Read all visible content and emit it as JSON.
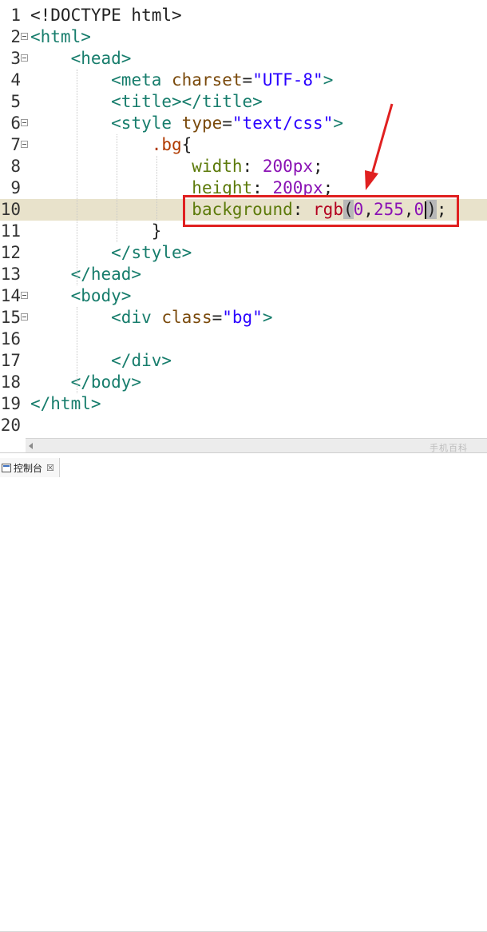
{
  "editor": {
    "lines": [
      {
        "num": "1",
        "tokens": [
          {
            "t": "<!DOCTYPE html>",
            "c": "default"
          }
        ]
      },
      {
        "num": "2",
        "tokens": [
          {
            "t": "<html>",
            "c": "tag"
          }
        ]
      },
      {
        "num": "3",
        "tokens": [
          {
            "t": "    ",
            "c": "default"
          },
          {
            "t": "<head>",
            "c": "tag"
          }
        ]
      },
      {
        "num": "4",
        "tokens": [
          {
            "t": "        ",
            "c": "default"
          },
          {
            "t": "<meta ",
            "c": "tag"
          },
          {
            "t": "charset",
            "c": "attr"
          },
          {
            "t": "=",
            "c": "default"
          },
          {
            "t": "\"UTF-8\"",
            "c": "str"
          },
          {
            "t": ">",
            "c": "tag"
          }
        ]
      },
      {
        "num": "5",
        "tokens": [
          {
            "t": "        ",
            "c": "default"
          },
          {
            "t": "<title></title>",
            "c": "tag"
          }
        ]
      },
      {
        "num": "6",
        "tokens": [
          {
            "t": "        ",
            "c": "default"
          },
          {
            "t": "<style ",
            "c": "tag"
          },
          {
            "t": "type",
            "c": "attr"
          },
          {
            "t": "=",
            "c": "default"
          },
          {
            "t": "\"text/css\"",
            "c": "str"
          },
          {
            "t": ">",
            "c": "tag"
          }
        ]
      },
      {
        "num": "7",
        "tokens": [
          {
            "t": "            ",
            "c": "default"
          },
          {
            "t": ".bg",
            "c": "sel"
          },
          {
            "t": "{",
            "c": "default"
          }
        ]
      },
      {
        "num": "8",
        "tokens": [
          {
            "t": "                ",
            "c": "default"
          },
          {
            "t": "width",
            "c": "prop"
          },
          {
            "t": ": ",
            "c": "default"
          },
          {
            "t": "200px",
            "c": "num"
          },
          {
            "t": ";",
            "c": "default"
          }
        ]
      },
      {
        "num": "9",
        "tokens": [
          {
            "t": "                ",
            "c": "default"
          },
          {
            "t": "height",
            "c": "prop"
          },
          {
            "t": ": ",
            "c": "default"
          },
          {
            "t": "200px",
            "c": "num"
          },
          {
            "t": ";",
            "c": "default"
          }
        ]
      },
      {
        "num": "10",
        "tokens": [
          {
            "t": "                ",
            "c": "default"
          },
          {
            "t": "background",
            "c": "prop"
          },
          {
            "t": ": ",
            "c": "default"
          },
          {
            "t": "rgb",
            "c": "fn"
          },
          {
            "t": "(",
            "c": "paren"
          },
          {
            "t": "0",
            "c": "num"
          },
          {
            "t": ",",
            "c": "default"
          },
          {
            "t": "255",
            "c": "num"
          },
          {
            "t": ",",
            "c": "default"
          },
          {
            "t": "0",
            "c": "num"
          },
          {
            "t": "caret",
            "c": "caret"
          },
          {
            "t": ")",
            "c": "paren"
          },
          {
            "t": ";",
            "c": "default"
          }
        ]
      },
      {
        "num": "11",
        "tokens": [
          {
            "t": "            ",
            "c": "default"
          },
          {
            "t": "}",
            "c": "default"
          }
        ]
      },
      {
        "num": "12",
        "tokens": [
          {
            "t": "        ",
            "c": "default"
          },
          {
            "t": "</style>",
            "c": "tag"
          }
        ]
      },
      {
        "num": "13",
        "tokens": [
          {
            "t": "    ",
            "c": "default"
          },
          {
            "t": "</head>",
            "c": "tag"
          }
        ]
      },
      {
        "num": "14",
        "tokens": [
          {
            "t": "    ",
            "c": "default"
          },
          {
            "t": "<body>",
            "c": "tag"
          }
        ]
      },
      {
        "num": "15",
        "tokens": [
          {
            "t": "        ",
            "c": "default"
          },
          {
            "t": "<div ",
            "c": "tag"
          },
          {
            "t": "class",
            "c": "attr"
          },
          {
            "t": "=",
            "c": "default"
          },
          {
            "t": "\"bg\"",
            "c": "str"
          },
          {
            "t": ">",
            "c": "tag"
          }
        ]
      },
      {
        "num": "16",
        "tokens": []
      },
      {
        "num": "17",
        "tokens": [
          {
            "t": "        ",
            "c": "default"
          },
          {
            "t": "</div>",
            "c": "tag"
          }
        ]
      },
      {
        "num": "18",
        "tokens": [
          {
            "t": "    ",
            "c": "default"
          },
          {
            "t": "</body>",
            "c": "tag"
          }
        ]
      },
      {
        "num": "19",
        "tokens": [
          {
            "t": "</html>",
            "c": "tag"
          }
        ]
      },
      {
        "num": "20",
        "tokens": []
      }
    ],
    "current_line": "10",
    "fold_lines": [
      "2",
      "3",
      "6",
      "7",
      "14",
      "15"
    ]
  },
  "bottom_panel": {
    "console_tab_label": "控制台",
    "console_close": "☒"
  },
  "watermark": "手机百科",
  "colors": {
    "annotation_red": "#e02020",
    "current_line_bg": "#e8e2cb"
  }
}
